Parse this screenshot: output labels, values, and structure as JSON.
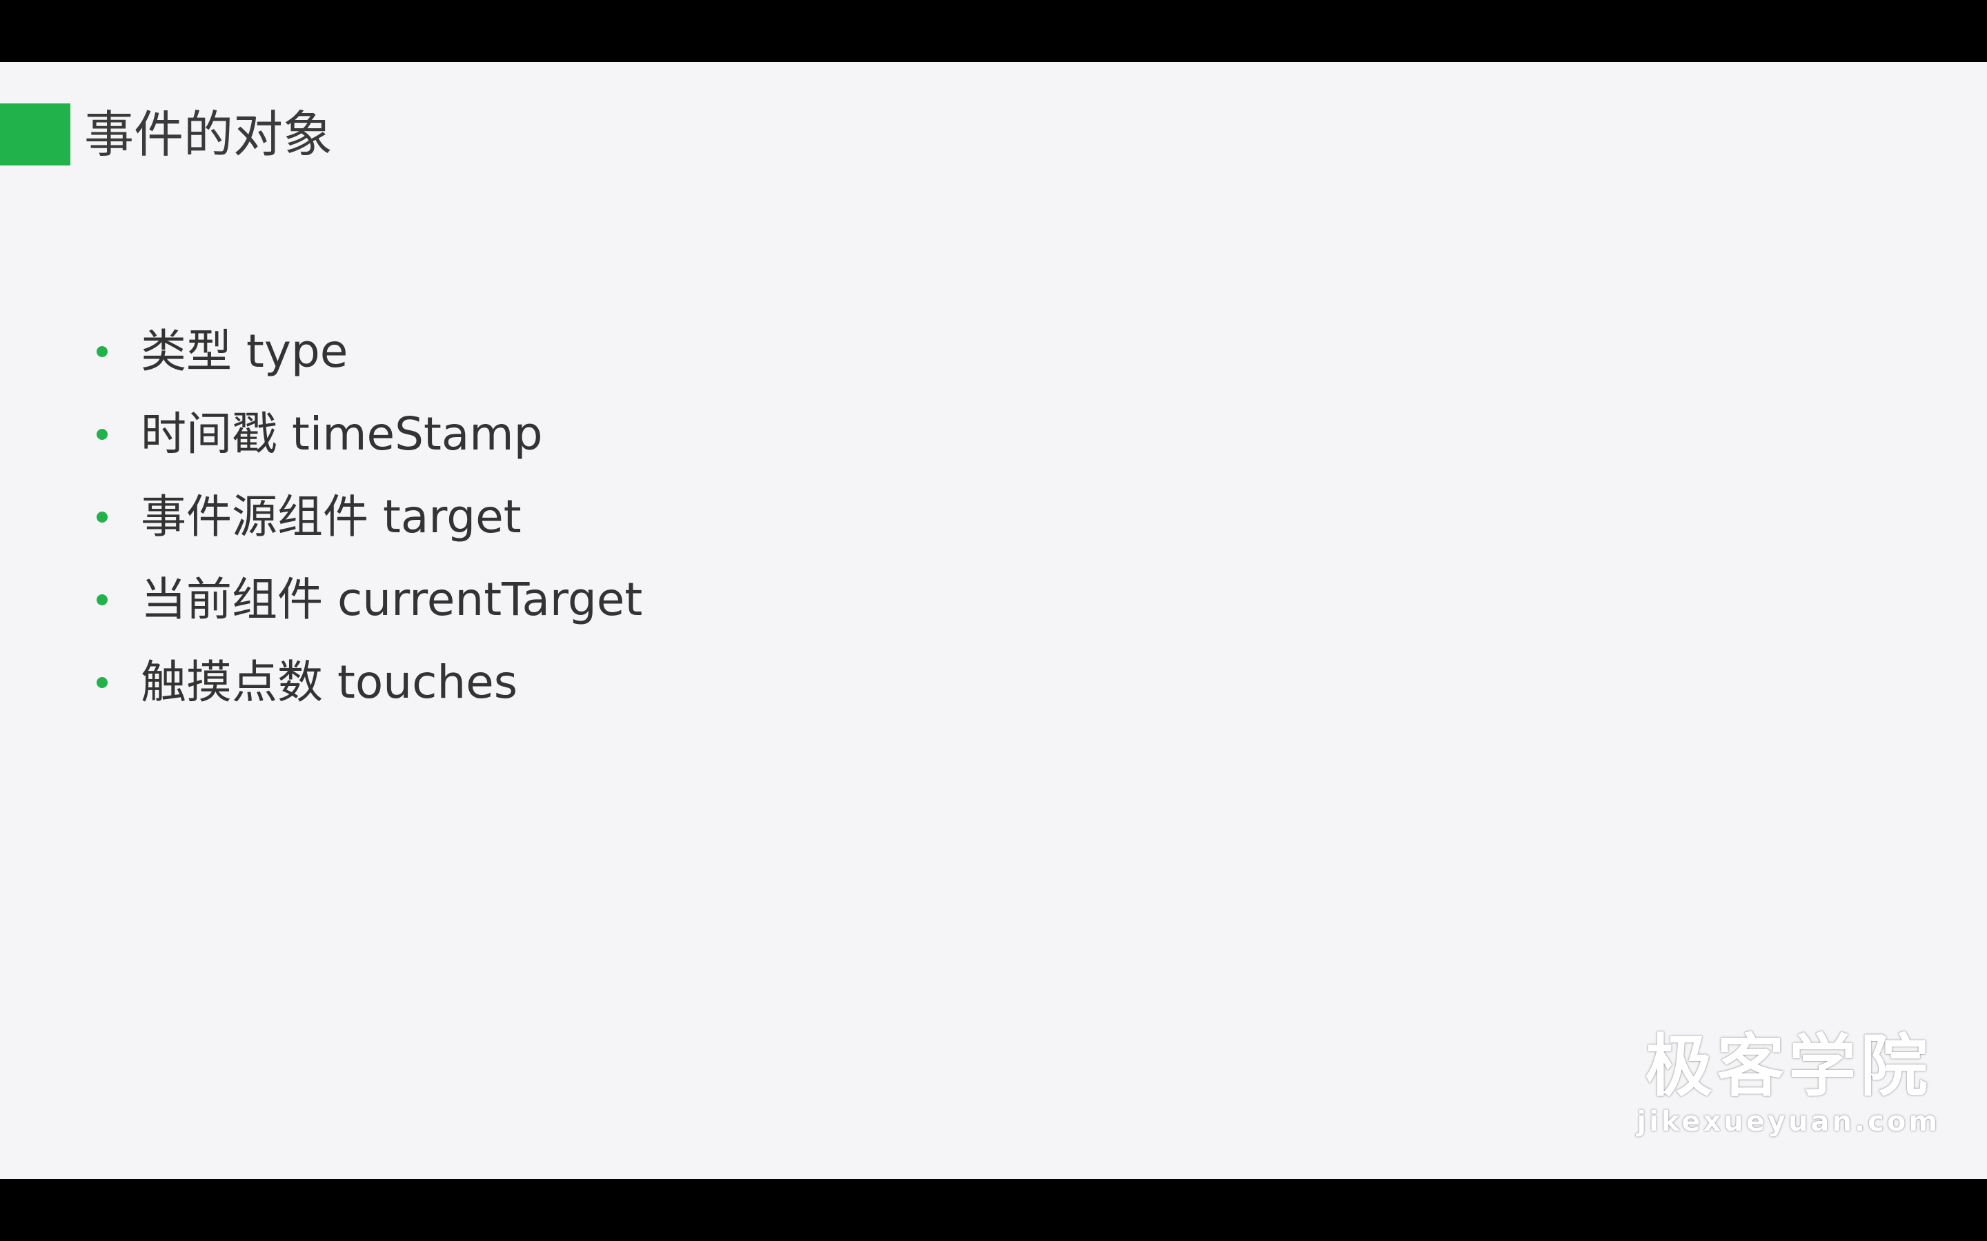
{
  "slide": {
    "title": "事件的对象",
    "accent_color": "#22b24c",
    "bullets": [
      "类型 type",
      "时间戳 timeStamp",
      "事件源组件 target",
      "当前组件 currentTarget",
      "触摸点数 touches"
    ]
  },
  "watermark": {
    "brand": "极客学院",
    "url": "jikexueyuan.com"
  }
}
